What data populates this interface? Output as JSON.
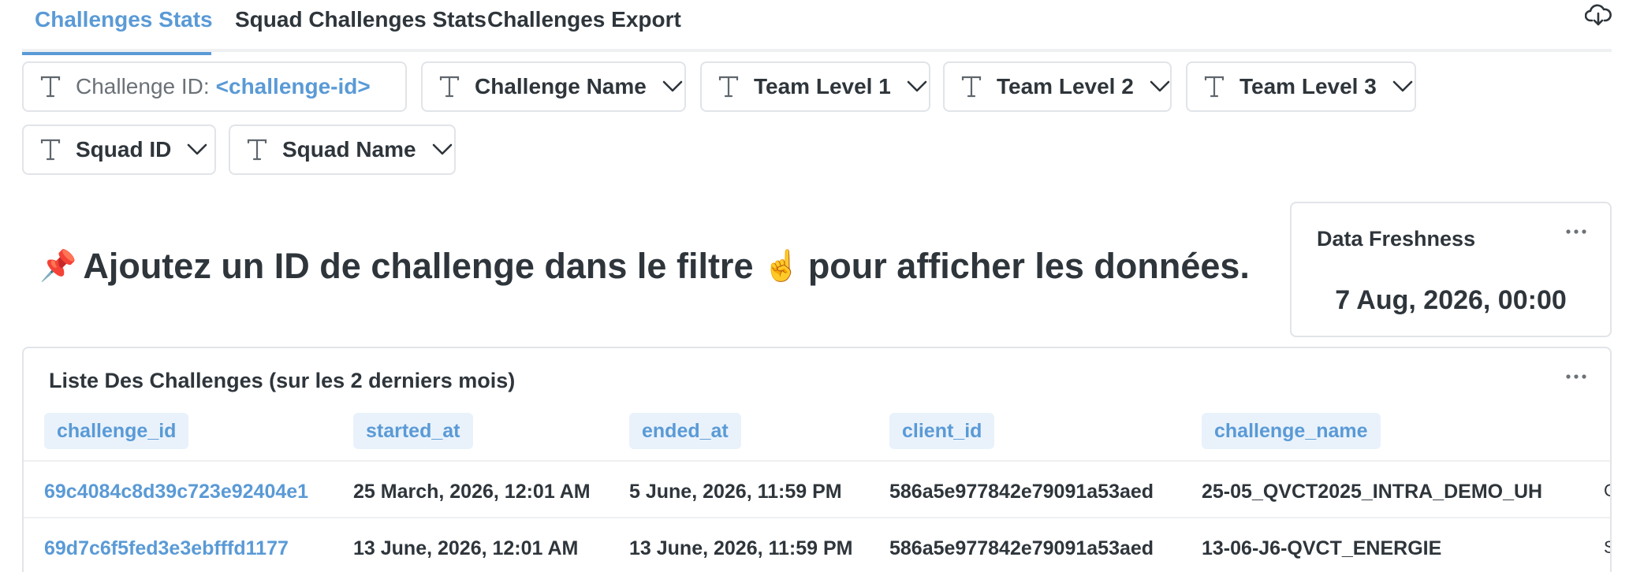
{
  "tabs": [
    {
      "label": "Challenges Stats",
      "active": true
    },
    {
      "label": "Squad Challenges Stats",
      "active": false
    },
    {
      "label": "Challenges Export",
      "active": false
    }
  ],
  "filters": {
    "challenge_id": {
      "label": "Challenge ID:",
      "value": "<challenge-id>"
    },
    "challenge_name": "Challenge Name",
    "team_level_1": "Team Level 1",
    "team_level_2": "Team Level 2",
    "team_level_3": "Team Level 3",
    "squad_id": "Squad ID",
    "squad_name": "Squad Name"
  },
  "heading": {
    "pin_emoji": "📌",
    "text_before": "Ajoutez un ID de challenge dans le filtre",
    "finger_emoji": "☝️",
    "text_after": "pour afficher les données."
  },
  "freshness": {
    "title": "Data Freshness",
    "value": "7 Aug, 2026, 00:00"
  },
  "table": {
    "title": "Liste Des Challenges (sur les 2 derniers mois)",
    "columns": [
      "challenge_id",
      "started_at",
      "ended_at",
      "client_id",
      "challenge_name"
    ],
    "rows": [
      [
        "69c4084c8d39c723e92404e1",
        "25 March, 2026, 12:01 AM",
        "5 June, 2026, 11:59 PM",
        "586a5e977842e79091a53aed",
        "25-05_QVCT2025_INTRA_DEMO_UH"
      ],
      [
        "69d7c6f5fed3e3ebfffd1177",
        "13 June, 2026, 12:01 AM",
        "13 June, 2026, 11:59 PM",
        "586a5e977842e79091a53aed",
        "13-06-J6-QVCT_ENERGIE"
      ]
    ],
    "next_column_glimpse": [
      "C",
      "S"
    ]
  },
  "colors": {
    "accent": "#5a9ad6",
    "text": "#2e353b",
    "border": "#e1e4e8",
    "header_bg": "#e9f2fb"
  }
}
